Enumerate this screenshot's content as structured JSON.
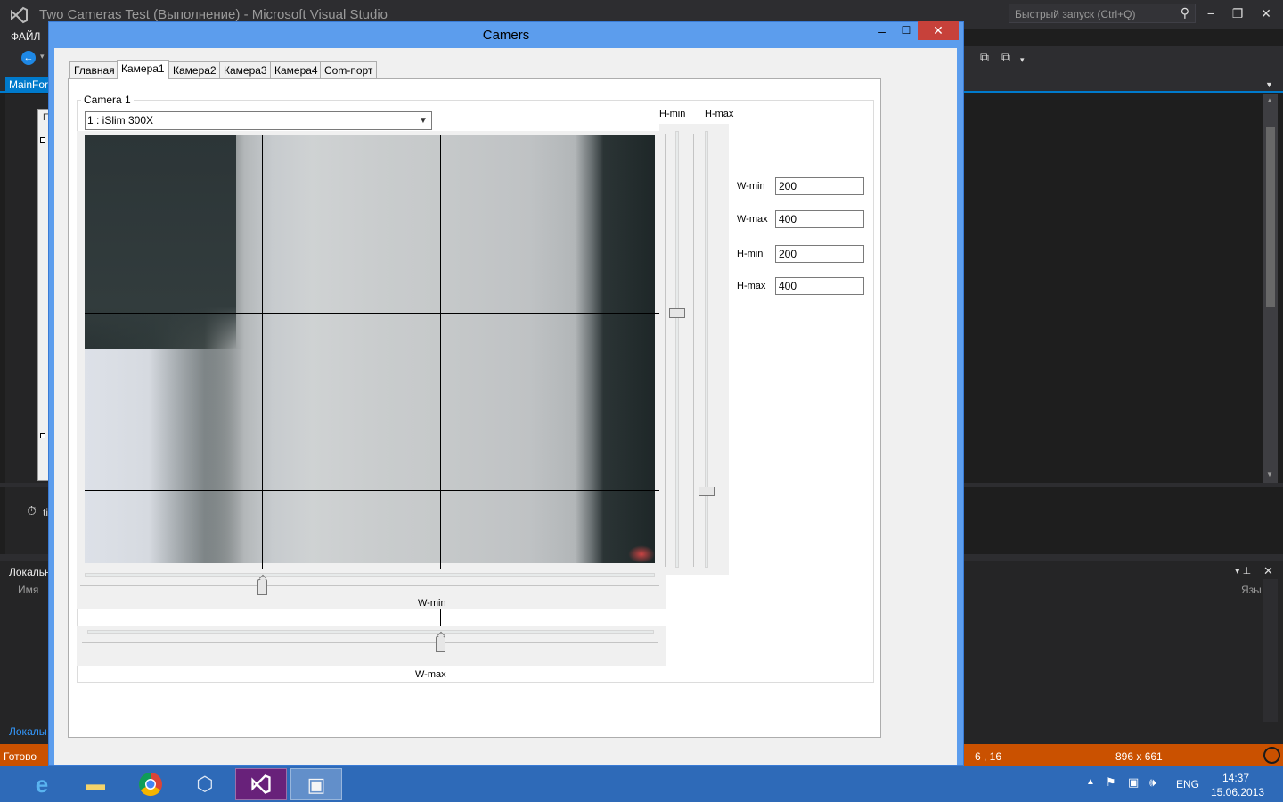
{
  "vs": {
    "title": "Two Cameras Test (Выполнение) - Microsoft Visual Studio",
    "quick_launch_placeholder": "Быстрый запуск (Ctrl+Q)",
    "menu_file": "ФАЙЛ",
    "doc_tab": "MainFor",
    "form_fragment": "П",
    "timer_label": "ti",
    "locals_title": "Локальн",
    "locals_col_name": "Имя",
    "locals_col_lang": "Язы",
    "locals_tab": "Локальн",
    "status_text": "Готово",
    "status_position": "6 , 16",
    "status_size": "896 x 661",
    "accent_color": "#007acc",
    "status_color": "#ca5100"
  },
  "taskbar": {
    "apps": [
      "internet-explorer-icon",
      "file-explorer-icon",
      "chrome-icon",
      "virtualbox-icon",
      "visual-studio-icon",
      "camers-app-icon"
    ],
    "tray_lang": "ENG",
    "time": "14:37",
    "date": "15.06.2013"
  },
  "window": {
    "title": "Camers",
    "tabs": [
      "Главная",
      "Камера1",
      "Камера2",
      "Камера3",
      "Камера4",
      "Com-порт"
    ],
    "selected_tab": "Камера1",
    "group_title": "Camera 1",
    "camera_select_value": "1 : iSlim 300X",
    "labels": {
      "h_min_top": "H-min",
      "h_max_top": "H-max",
      "w_min_slider": "W-min",
      "w_max_slider": "W-max"
    },
    "fields": [
      {
        "label": "W-min",
        "value": "200"
      },
      {
        "label": "W-max",
        "value": "400"
      },
      {
        "label": "H-min",
        "value": "200"
      },
      {
        "label": "H-max",
        "value": "400"
      }
    ]
  }
}
